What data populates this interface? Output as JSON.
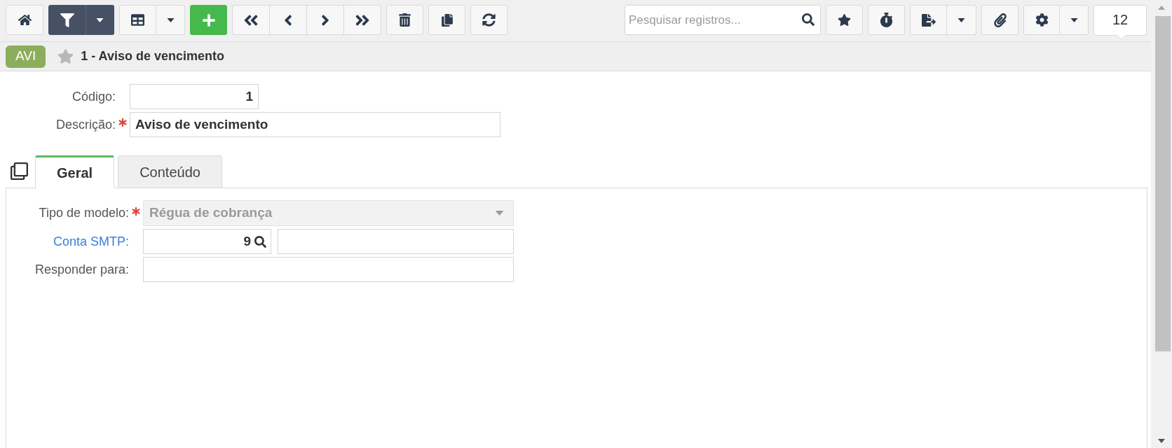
{
  "toolbar": {
    "filter_active": true,
    "search": {
      "placeholder": "Pesquisar registros..."
    },
    "record_count": "12"
  },
  "title_bar": {
    "badge": "AVI",
    "favorite": false,
    "title": "1 - Aviso de vencimento"
  },
  "form": {
    "fields": [
      {
        "label": "Código:",
        "required": false,
        "kind": "number",
        "value": "1"
      },
      {
        "label": "Descrição:",
        "required": true,
        "kind": "text",
        "value": "Aviso de vencimento"
      }
    ]
  },
  "tabs": [
    {
      "label": "Geral",
      "selected": true
    },
    {
      "label": "Conteúdo",
      "selected": false
    }
  ],
  "panel": {
    "fields": [
      {
        "label": "Tipo de modelo:",
        "required": true,
        "link": false,
        "disabled": true,
        "kind": "select",
        "value": "Régua de cobrança"
      },
      {
        "label": "Conta SMTP:",
        "required": false,
        "link": true,
        "disabled": false,
        "kind": "lookup",
        "value": "9"
      },
      {
        "label": "Responder para:",
        "required": false,
        "link": false,
        "disabled": false,
        "kind": "text"
      }
    ]
  }
}
